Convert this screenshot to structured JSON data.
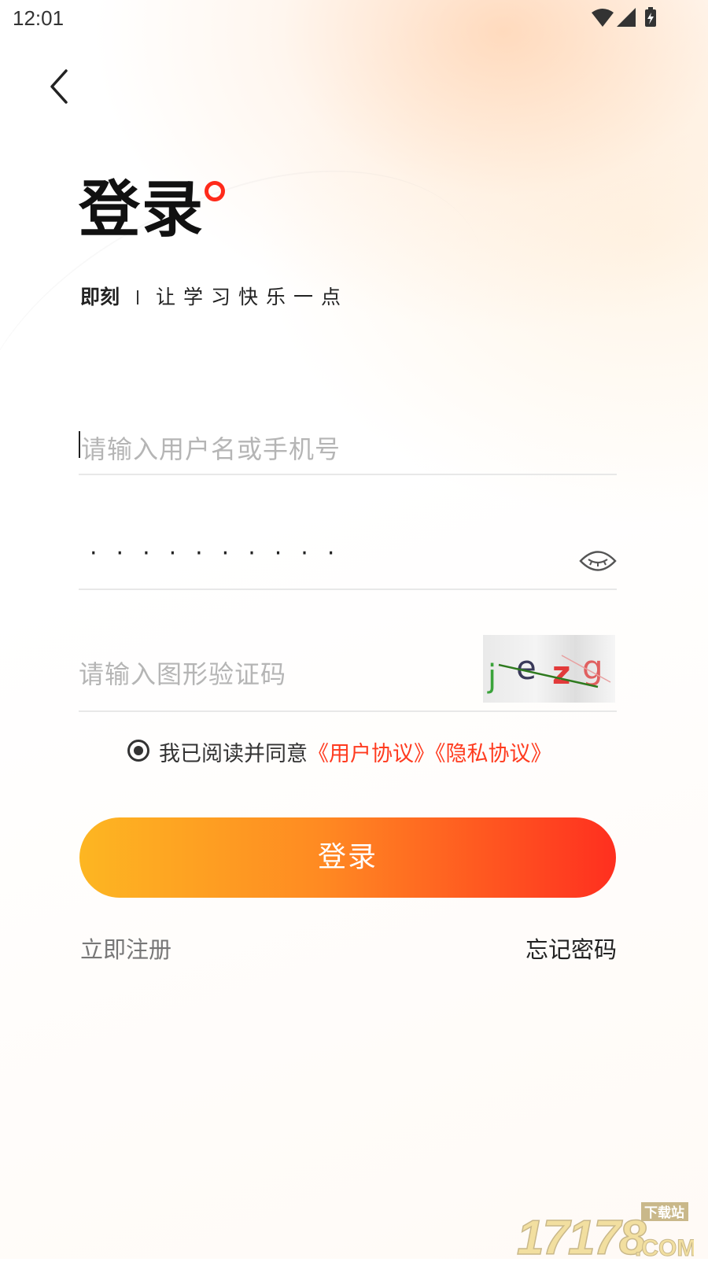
{
  "status_bar": {
    "time": "12:01"
  },
  "header": {
    "title": "登录",
    "brand": "即刻",
    "tagline": "让学习快乐一点"
  },
  "form": {
    "username": {
      "placeholder": "请输入用户名或手机号"
    },
    "password": {
      "masked_value": "··········"
    },
    "captcha": {
      "placeholder": "请输入图形验证码",
      "image_text": "jezg"
    }
  },
  "agreement": {
    "checked": true,
    "text": "我已阅读并同意",
    "user_agreement": "《用户协议》",
    "privacy_agreement": "《隐私协议》"
  },
  "actions": {
    "login": "登录",
    "register": "立即注册",
    "forgot_password": "忘记密码"
  },
  "watermark": {
    "number": "17178",
    "label": "下载站",
    "suffix": ".COM"
  },
  "colors": {
    "accent": "#ff3b1f",
    "button_start": "#fdb622",
    "button_end": "#ff2f1f"
  }
}
